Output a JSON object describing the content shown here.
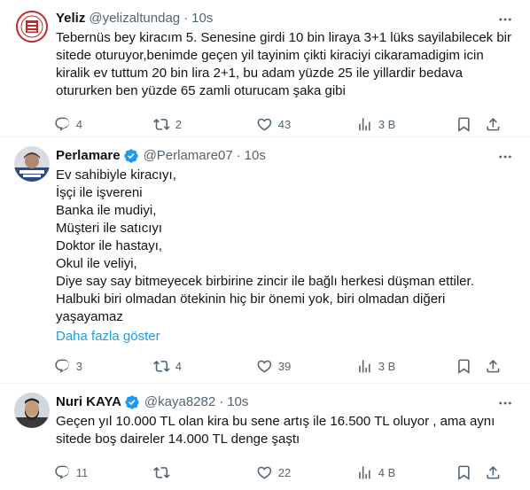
{
  "tweets": [
    {
      "name": "Yeliz",
      "verified": false,
      "handle": "@yelizaltundag",
      "time": "10s",
      "text": "Tebernüs bey kiracım 5. Senesine girdi 10 bin liraya 3+1 lüks sayilabilecek bir sitede oturuyor,benimde geçen yil tayinim çikti kiraciyi cikaramadigim icin kiralik ev tuttum 20 bin lira 2+1, bu adam yüzde 25 ile yillardir bedava otururken ben yüzde 65 zamli oturucam şaka gibi",
      "show_more": "",
      "replies": "4",
      "retweets": "2",
      "likes": "43",
      "views": "3 B",
      "avatar_icon": "red-emblem-avatar"
    },
    {
      "name": "Perlamare",
      "verified": true,
      "handle": "@Perlamare07",
      "time": "10s",
      "text": "Ev sahibiyle kiracıyı,\nİşçi ile işvereni\nBanka ile mudiyi,\nMüşteri ile satıcıyı\nDoktor ile hastayı,\nOkul ile veliyi,\nDiye say say bitmeyecek birbirine zincir ile bağlı herkesi düşman ettiler.\nHalbuki biri olmadan ötekinin hiç bir önemi yok, biri olmadan diğeri yaşayamaz",
      "show_more": "Daha fazla göster",
      "replies": "3",
      "retweets": "4",
      "likes": "39",
      "views": "3 B",
      "avatar_icon": "portrait-avatar"
    },
    {
      "name": "Nuri KAYA",
      "verified": true,
      "handle": "@kaya8282",
      "time": "10s",
      "text": "Geçen yıl 10.000 TL olan kira bu sene artış ile 16.500 TL oluyor , ama aynı sitede boş daireler 14.000 TL denge şaştı",
      "show_more": "",
      "replies": "11",
      "retweets": "",
      "likes": "22",
      "views": "4 B",
      "avatar_icon": "bearded-man-avatar"
    }
  ],
  "separator": "·",
  "colors": {
    "text": "#0f1419",
    "muted": "#536471",
    "link": "#1d9bf0",
    "verified": "#1d9bf0",
    "divider": "#eff3f4"
  }
}
